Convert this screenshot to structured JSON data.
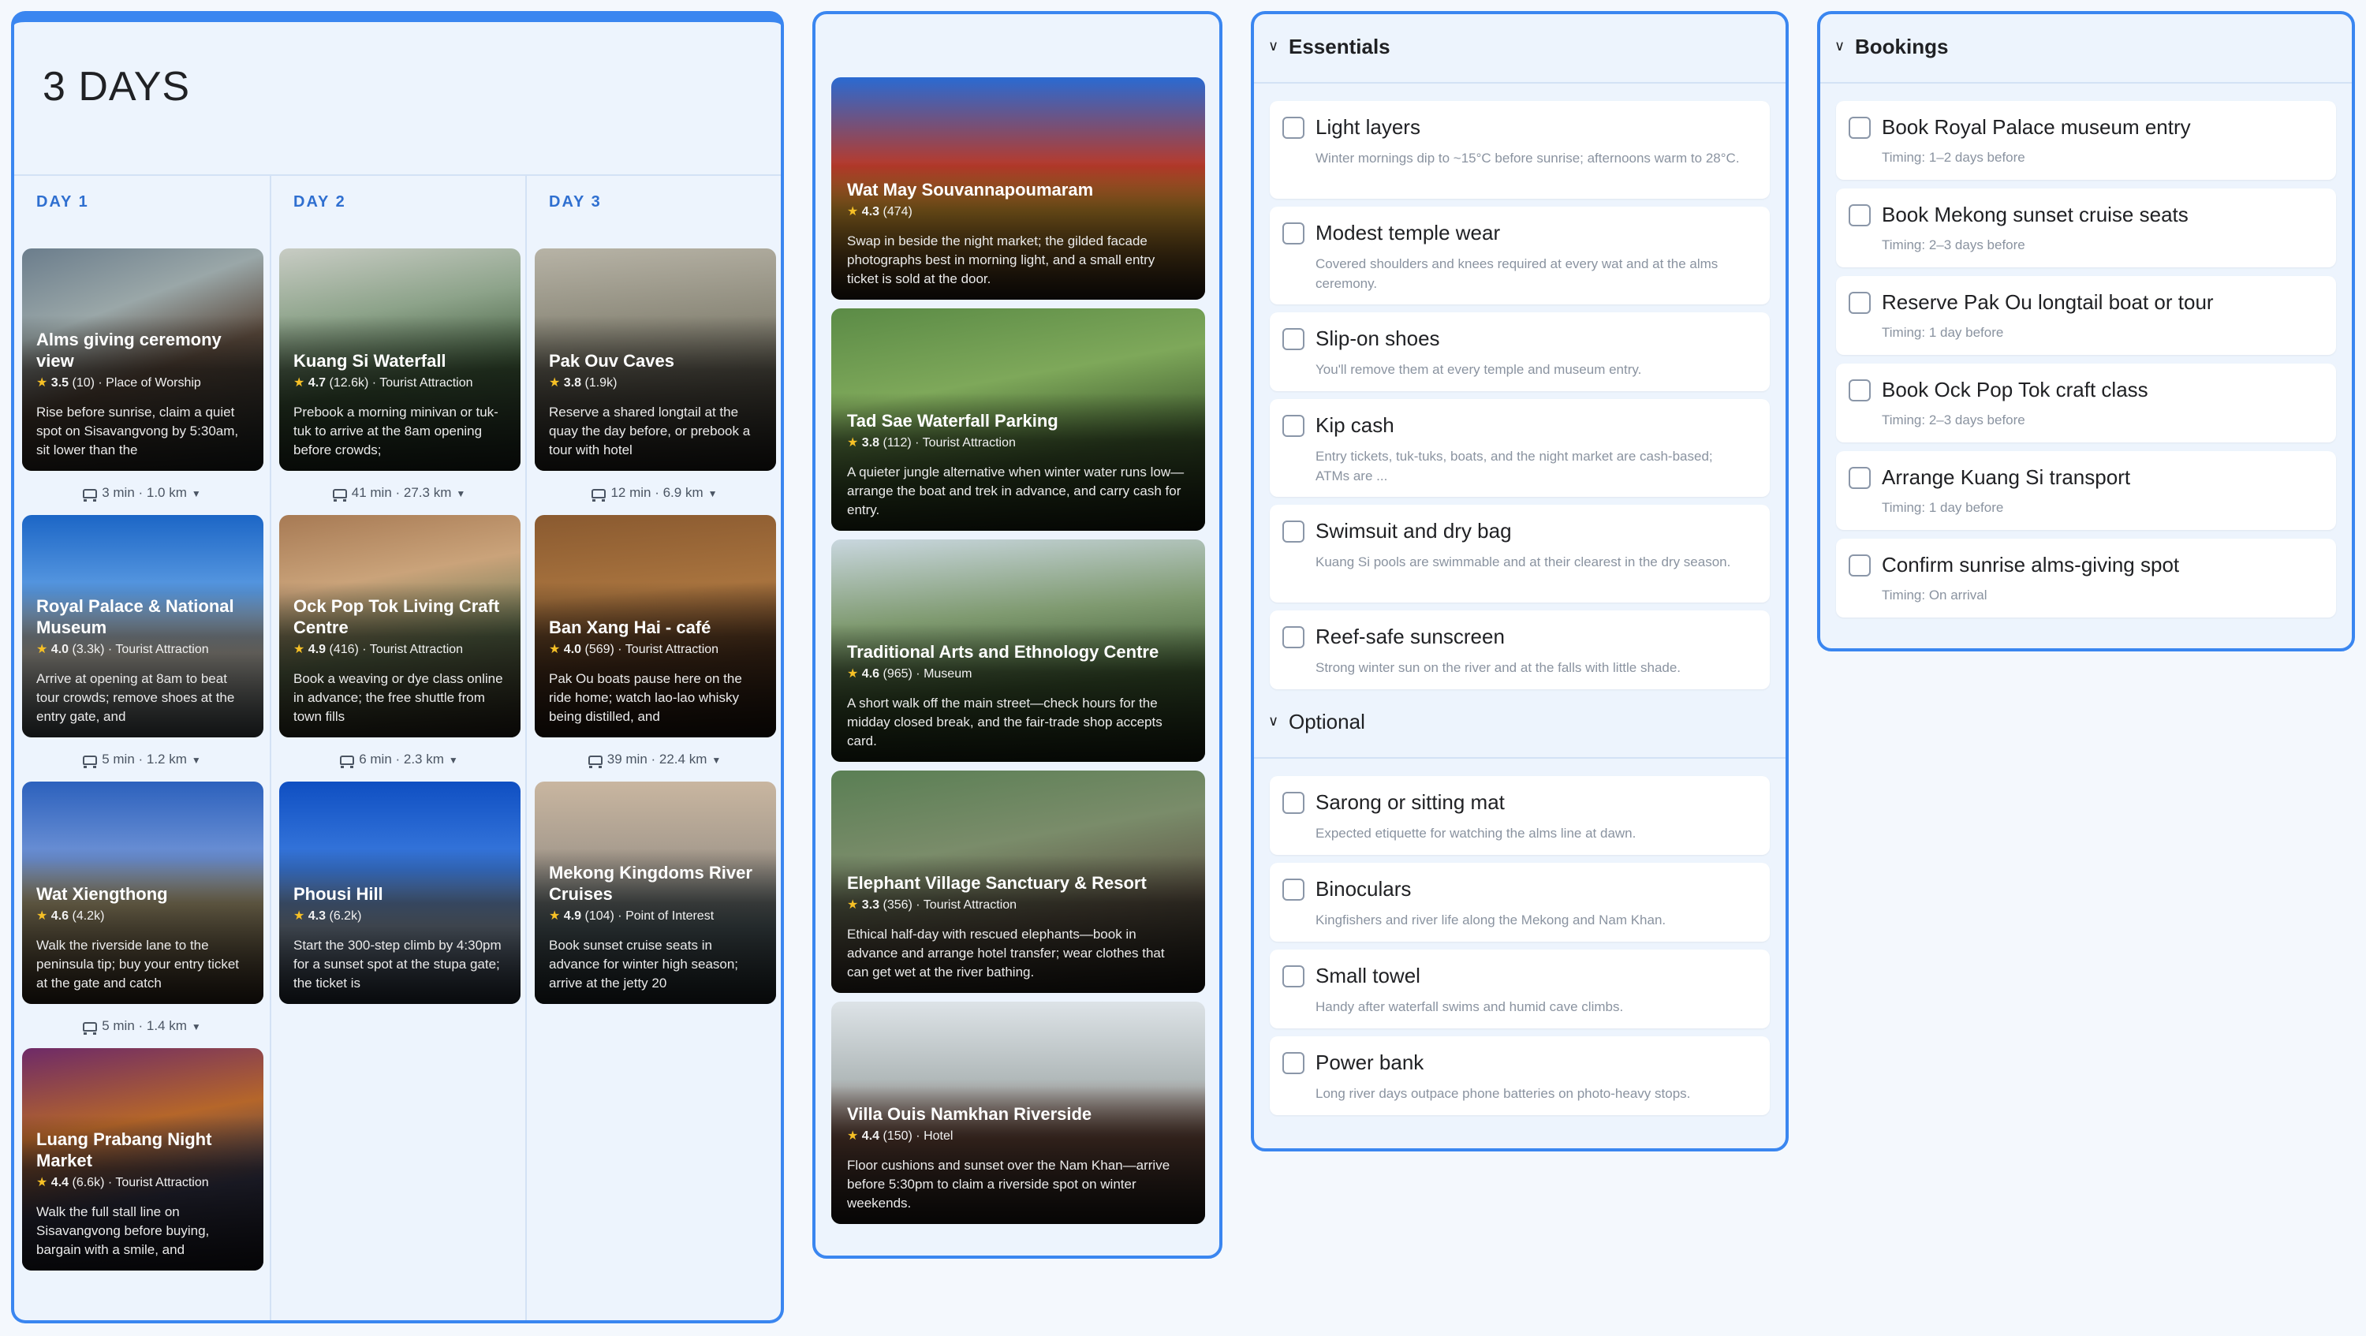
{
  "days": {
    "title": "3 DAYS",
    "columns": [
      {
        "label": "DAY 1",
        "cards": [
          {
            "name": "Alms giving ceremony view",
            "rating": "3.5",
            "reviews": "(10)",
            "category": "Place of Worship",
            "desc": "Rise before sunrise, claim a quiet spot on Sisavangvong by 5:30am, sit lower than the"
          },
          {
            "name": "Royal Palace & National Museum",
            "rating": "4.0",
            "reviews": "(3.3k)",
            "category": "Tourist Attraction",
            "desc": "Arrive at opening at 8am to beat tour crowds; remove shoes at the entry gate, and"
          },
          {
            "name": "Wat Xiengthong",
            "rating": "4.6",
            "reviews": "(4.2k)",
            "category": "",
            "desc": "Walk the riverside lane to the peninsula tip; buy your entry ticket at the gate and catch"
          },
          {
            "name": "Luang Prabang Night Market",
            "rating": "4.4",
            "reviews": "(6.6k)",
            "category": "Tourist Attraction",
            "desc": "Walk the full stall line on Sisavangvong before buying, bargain with a smile, and"
          }
        ],
        "travel": [
          "3 min · 1.0 km",
          "5 min · 1.2 km",
          "5 min · 1.4 km"
        ]
      },
      {
        "label": "DAY 2",
        "cards": [
          {
            "name": "Kuang Si Waterfall",
            "rating": "4.7",
            "reviews": "(12.6k)",
            "category": "Tourist Attraction",
            "desc": "Prebook a morning minivan or tuk-tuk to arrive at the 8am opening before crowds;"
          },
          {
            "name": "Ock Pop Tok Living Craft Centre",
            "rating": "4.9",
            "reviews": "(416)",
            "category": "Tourist Attraction",
            "desc": "Book a weaving or dye class online in advance; the free shuttle from town fills"
          },
          {
            "name": "Phousi Hill",
            "rating": "4.3",
            "reviews": "(6.2k)",
            "category": "",
            "desc": "Start the 300-step climb by 4:30pm for a sunset spot at the stupa gate; the ticket is"
          }
        ],
        "travel": [
          "41 min · 27.3 km",
          "6 min · 2.3 km"
        ]
      },
      {
        "label": "DAY 3",
        "cards": [
          {
            "name": "Pak Ouv Caves",
            "rating": "3.8",
            "reviews": "(1.9k)",
            "category": "",
            "desc": "Reserve a shared longtail at the quay the day before, or prebook a tour with hotel"
          },
          {
            "name": "Ban Xang Hai - café",
            "rating": "4.0",
            "reviews": "(569)",
            "category": "Tourist Attraction",
            "desc": "Pak Ou boats pause here on the ride home; watch lao-lao whisky being distilled, and"
          },
          {
            "name": "Mekong Kingdoms River Cruises",
            "rating": "4.9",
            "reviews": "(104)",
            "category": "Point of Interest",
            "desc": "Book sunset cruise seats in advance for winter high season; arrive at the jetty 20"
          }
        ],
        "travel": [
          "12 min · 6.9 km",
          "39 min · 22.4 km"
        ]
      }
    ]
  },
  "places": [
    {
      "name": "Wat May Souvannapoumaram",
      "rating": "4.3",
      "reviews": "(474)",
      "category": "",
      "desc": "Swap in beside the night market; the gilded facade photographs best in morning light, and a small entry ticket is sold at the door."
    },
    {
      "name": "Tad Sae Waterfall Parking",
      "rating": "3.8",
      "reviews": "(112)",
      "category": "Tourist Attraction",
      "desc": "A quieter jungle alternative when winter water runs low—arrange the boat and trek in advance, and carry cash for entry."
    },
    {
      "name": "Traditional Arts and Ethnology Centre",
      "rating": "4.6",
      "reviews": "(965)",
      "category": "Museum",
      "desc": "A short walk off the main street—check hours for the midday closed break, and the fair-trade shop accepts card."
    },
    {
      "name": "Elephant Village Sanctuary & Resort",
      "rating": "3.3",
      "reviews": "(356)",
      "category": "Tourist Attraction",
      "desc": "Ethical half-day with rescued elephants—book in advance and arrange hotel transfer; wear clothes that can get wet at the river bathing."
    },
    {
      "name": "Villa Ouis Namkhan Riverside",
      "rating": "4.4",
      "reviews": "(150)",
      "category": "Hotel",
      "desc": "Floor cushions and sunset over the Nam Khan—arrive before 5:30pm to claim a riverside spot on winter weekends."
    }
  ],
  "essentials": {
    "title": "Essentials",
    "items": [
      {
        "label": "Light layers",
        "note": "Winter mornings dip to ~15°C before sunrise; afternoons warm to 28°C."
      },
      {
        "label": "Modest temple wear",
        "note": "Covered shoulders and knees required at every wat and at the alms ceremony."
      },
      {
        "label": "Slip-on shoes",
        "note": "You'll remove them at every temple and museum entry."
      },
      {
        "label": "Kip cash",
        "note": "Entry tickets, tuk-tuks, boats, and the night market are cash-based; ATMs are ..."
      },
      {
        "label": "Swimsuit and dry bag",
        "note": "Kuang Si pools are swimmable and at their clearest in the dry season."
      },
      {
        "label": "Reef-safe sunscreen",
        "note": "Strong winter sun on the river and at the falls with little shade."
      }
    ]
  },
  "optional": {
    "title": "Optional",
    "items": [
      {
        "label": "Sarong or sitting mat",
        "note": "Expected etiquette for watching the alms line at dawn."
      },
      {
        "label": "Binoculars",
        "note": "Kingfishers and river life along the Mekong and Nam Khan."
      },
      {
        "label": "Small towel",
        "note": "Handy after waterfall swims and humid cave climbs."
      },
      {
        "label": "Power bank",
        "note": "Long river days outpace phone batteries on photo-heavy stops."
      }
    ]
  },
  "bookings": {
    "title": "Bookings",
    "items": [
      {
        "label": "Book Royal Palace museum entry",
        "timing": "Timing: 1–2 days before"
      },
      {
        "label": "Book Mekong sunset cruise seats",
        "timing": "Timing: 2–3 days before"
      },
      {
        "label": "Reserve Pak Ou longtail boat or tour",
        "timing": "Timing: 1 day before"
      },
      {
        "label": "Book Ock Pop Tok craft class",
        "timing": "Timing: 2–3 days before"
      },
      {
        "label": "Arrange Kuang Si transport",
        "timing": "Timing: 1 day before"
      },
      {
        "label": "Confirm sunrise alms-giving spot",
        "timing": "Timing: On arrival"
      }
    ]
  }
}
